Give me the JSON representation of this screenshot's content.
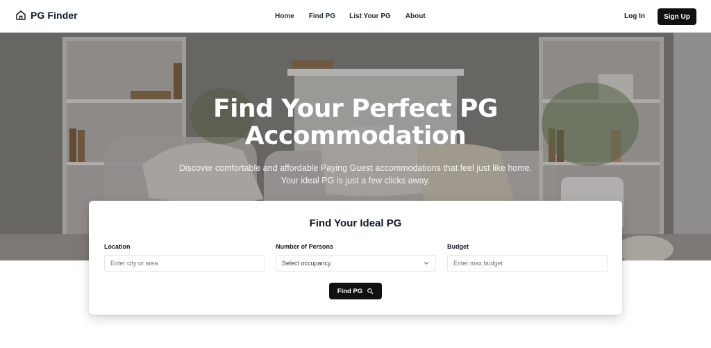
{
  "brand": {
    "name": "PG Finder",
    "icon": "home-icon"
  },
  "nav": {
    "links": [
      "Home",
      "Find PG",
      "List Your PG",
      "About"
    ],
    "login": "Log In",
    "signup": "Sign Up"
  },
  "hero": {
    "title": "Find Your Perfect PG Accommodation",
    "subtitle": "Discover comfortable and affordable Paying Guest accommodations that feel just like home. Your ideal PG is just a few clicks away."
  },
  "search": {
    "title": "Find Your Ideal PG",
    "location": {
      "label": "Location",
      "placeholder": "Enter city or area"
    },
    "persons": {
      "label": "Number of Persons",
      "value": "Select occupancy"
    },
    "budget": {
      "label": "Budget",
      "placeholder": "Enter max budget"
    },
    "button": "Find PG",
    "button_icon": "search-icon"
  },
  "colors": {
    "primary": "#111111",
    "text": "#111827",
    "border": "#e5e7eb"
  }
}
